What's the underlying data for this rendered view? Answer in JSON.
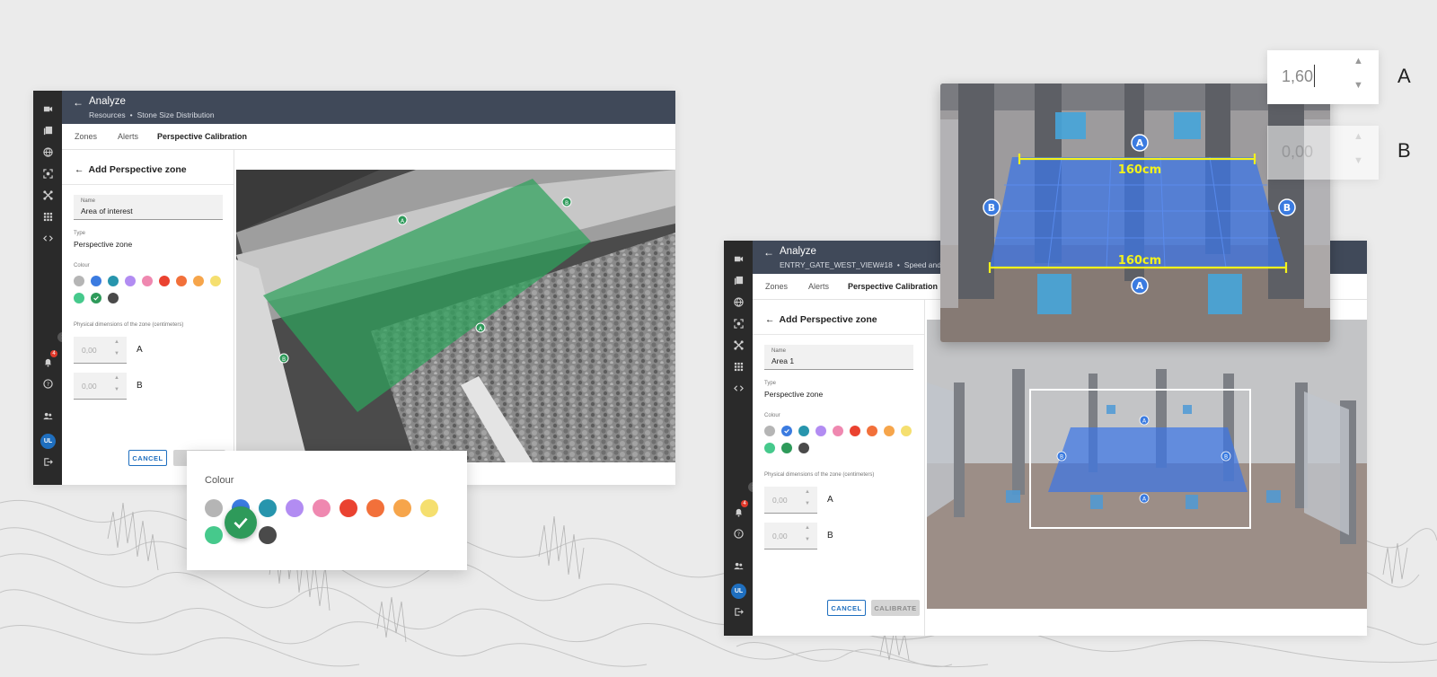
{
  "palette": [
    "#b5b5b5",
    "#3b7be0",
    "#2795ad",
    "#b28cf2",
    "#ef88b0",
    "#ea4230",
    "#f2703a",
    "#f6a54b",
    "#f5df6f",
    "#46c98c",
    "#2e9a5a",
    "#4a4a4a"
  ],
  "left": {
    "title": "Analyze",
    "crumb_1": "Resources",
    "crumb_2": "Stone Size Distribution",
    "tabs": [
      "Zones",
      "Alerts",
      "Perspective Calibration"
    ],
    "panel_title": "Add Perspective zone",
    "name_label": "Name",
    "name_value": "Area of interest",
    "type_label": "Type",
    "type_value": "Perspective zone",
    "colour_label": "Colour",
    "dims_label": "Physical dimensions of the zone (centimeters)",
    "dim_a_value": "0,00",
    "dim_a_label": "A",
    "dim_b_value": "0,00",
    "dim_b_label": "B",
    "cancel_label": "CANCEL",
    "notification_count": "4",
    "avatar": "UL",
    "zone_markers": [
      "A",
      "B",
      "A",
      "B"
    ],
    "selected_colour": "#2e9a5a"
  },
  "popup": {
    "title": "Colour"
  },
  "right": {
    "title": "Analyze",
    "crumb_1": "ENTRY_GATE_WEST_VIEW#18",
    "crumb_2": "Speed and",
    "tabs": [
      "Zones",
      "Alerts",
      "Perspective Calibration"
    ],
    "panel_title": "Add Perspective zone",
    "name_label": "Name",
    "name_value": "Area 1",
    "type_label": "Type",
    "type_value": "Perspective zone",
    "colour_label": "Colour",
    "dims_label": "Physical dimensions of the zone (centimeters)",
    "dim_a_value": "0,00",
    "dim_a_label": "A",
    "dim_b_value": "0,00",
    "dim_b_label": "B",
    "cancel_label": "CANCEL",
    "calibrate_label": "CALIBRATE",
    "notification_count": "4",
    "avatar": "UL",
    "zone_markers": [
      "A",
      "B",
      "B",
      "A"
    ],
    "selected_colour": "#3b7be0"
  },
  "zoom": {
    "markers": [
      "A",
      "B",
      "B",
      "A"
    ],
    "top_measure": "160cm",
    "bottom_measure": "160cm"
  },
  "big_inputs": {
    "a_value": "1,60",
    "a_label": "A",
    "b_value": "0,00",
    "b_label": "B"
  }
}
